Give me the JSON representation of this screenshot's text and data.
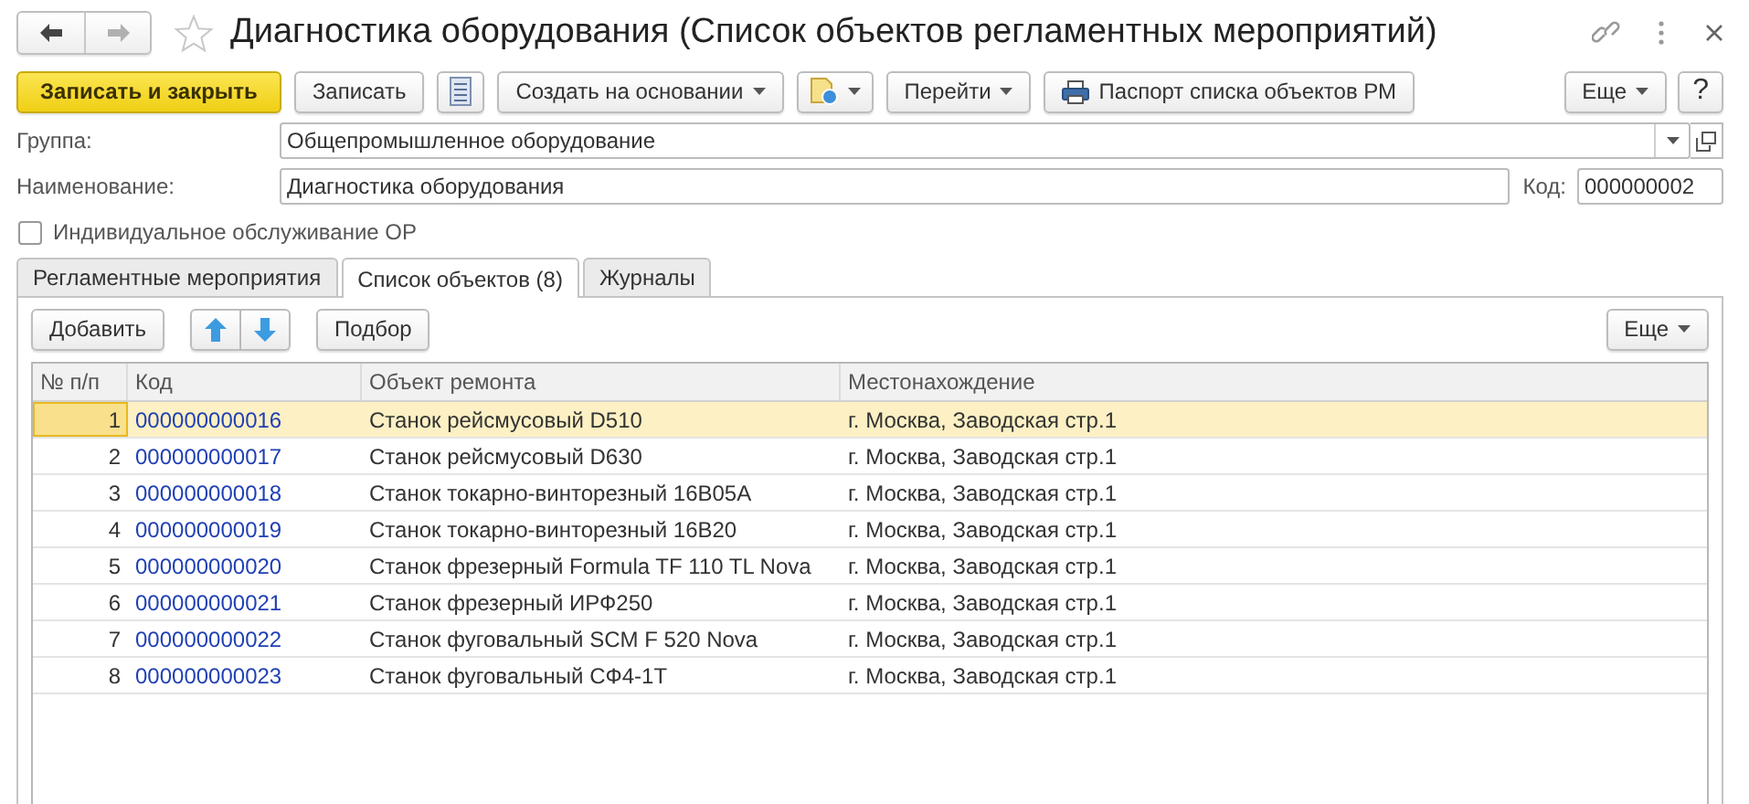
{
  "window": {
    "title": "Диагностика оборудования (Список объектов регламентных мероприятий)",
    "starred": false
  },
  "nav": [
    {
      "kind": "back",
      "disabled": false
    },
    {
      "kind": "forward",
      "disabled": true
    }
  ],
  "toolbar": [
    {
      "kind": "primary",
      "label": "Записать и закрыть"
    },
    {
      "kind": "button",
      "label": "Записать"
    },
    {
      "kind": "structure"
    },
    {
      "kind": "menu",
      "label": "Создать на основании"
    },
    {
      "kind": "reports"
    },
    {
      "kind": "menu",
      "label": "Перейти"
    },
    {
      "kind": "print",
      "label": "Паспорт списка объектов РМ"
    }
  ],
  "toolbar_right": [
    {
      "kind": "menu",
      "label": "Еще"
    },
    {
      "kind": "help",
      "label": "?"
    }
  ],
  "group": {
    "label": "Группа:",
    "value": "Общепромышленное оборудование"
  },
  "name": {
    "label": "Наименование:",
    "value": "Диагностика оборудования"
  },
  "code": {
    "label": "Код:",
    "value": "000000002"
  },
  "individual": {
    "label": "Индивидуальное обслуживание ОР",
    "checked": false
  },
  "tabs": [
    {
      "label": "Регламентные мероприятия",
      "selected": false
    },
    {
      "label": "Список объектов (8)",
      "selected": true
    },
    {
      "label": "Журналы",
      "selected": false
    }
  ],
  "table_toolbar": [
    {
      "kind": "button",
      "label": "Добавить"
    },
    {
      "kind": "updown"
    },
    {
      "kind": "button",
      "label": "Подбор"
    }
  ],
  "table_toolbar_right": [
    {
      "kind": "menu",
      "label": "Еще"
    }
  ],
  "table": {
    "columns": [
      "№ п/п",
      "Код",
      "Объект ремонта",
      "Местонахождение"
    ],
    "rows": [
      {
        "number": "1",
        "code": "000000000016",
        "object": "Станок рейсмусовый D510",
        "location": "г. Москва, Заводская стр.1",
        "selected": true
      },
      {
        "number": "2",
        "code": "000000000017",
        "object": "Станок рейсмусовый D630",
        "location": "г. Москва, Заводская стр.1",
        "selected": false
      },
      {
        "number": "3",
        "code": "000000000018",
        "object": "Станок токарно-винторезный 16В05А",
        "location": "г. Москва, Заводская стр.1",
        "selected": false
      },
      {
        "number": "4",
        "code": "000000000019",
        "object": "Станок токарно-винторезный 16В20",
        "location": "г. Москва, Заводская стр.1",
        "selected": false
      },
      {
        "number": "5",
        "code": "000000000020",
        "object": "Станок фрезерный Formula TF 110 TL Nova",
        "location": "г. Москва, Заводская стр.1",
        "selected": false
      },
      {
        "number": "6",
        "code": "000000000021",
        "object": "Станок фрезерный ИРФ250",
        "location": "г. Москва, Заводская стр.1",
        "selected": false
      },
      {
        "number": "7",
        "code": "000000000022",
        "object": "Станок фуговальный SCM F 520 Nova",
        "location": "г. Москва, Заводская стр.1",
        "selected": false
      },
      {
        "number": "8",
        "code": "000000000023",
        "object": "Станок фуговальный СФ4-1Т",
        "location": "г. Москва, Заводская стр.1",
        "selected": false
      }
    ]
  }
}
